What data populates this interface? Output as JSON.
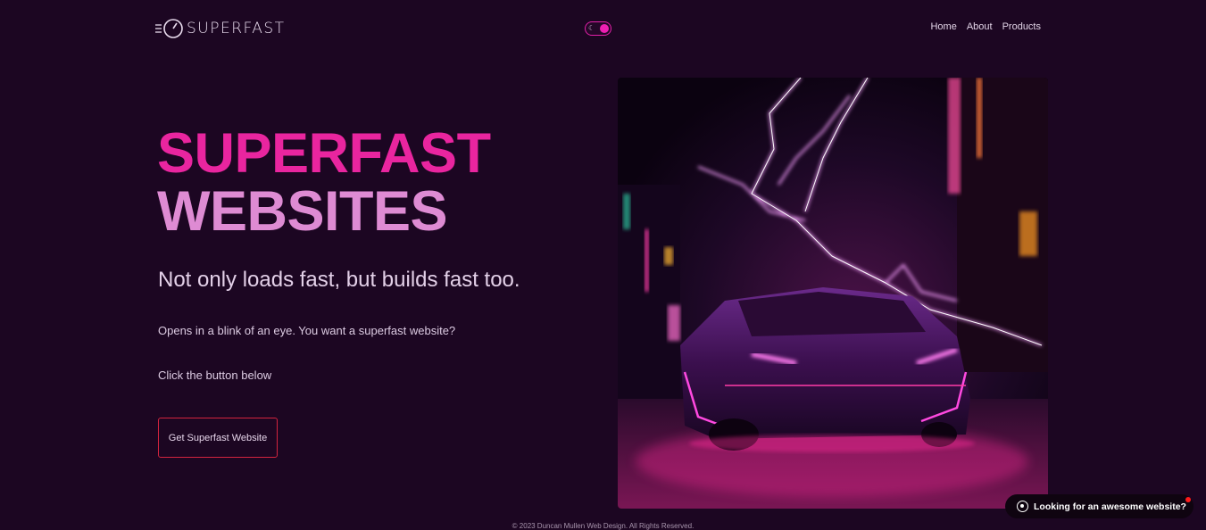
{
  "brand": {
    "logo_text": "SUPERFAST",
    "icon": "speedometer-icon"
  },
  "theme_toggle": {
    "icon": "moon-icon",
    "state": "on"
  },
  "nav": {
    "items": [
      {
        "label": "Home"
      },
      {
        "label": "About"
      },
      {
        "label": "Products"
      }
    ]
  },
  "hero": {
    "title_line1": "SUPERFAST",
    "title_line2": "WEBSITES",
    "subtitle": "Not only loads fast, but builds fast too.",
    "description": "Opens in a blink of an eye. You want a superfast website?",
    "prompt": "Click the button below",
    "cta_label": "Get Superfast Website",
    "image_subject": "neon sports car with lightning"
  },
  "footer": {
    "text": "© 2023 Duncan Mullen Web Design. All Rights Reserved."
  },
  "whatsapp_widget": {
    "label": "Looking for an awesome website?",
    "icon": "whatsapp-icon",
    "notification": true
  },
  "colors": {
    "background": "#1c0622",
    "accent_pink": "#e9259f",
    "accent_light_pink": "#de8bd3",
    "cta_border": "#d3243f"
  }
}
